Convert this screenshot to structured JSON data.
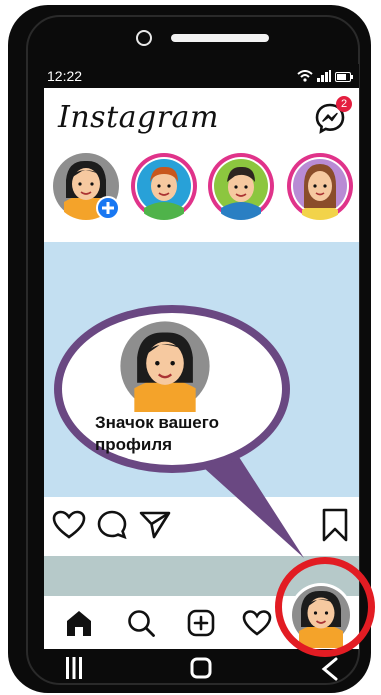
{
  "status_bar": {
    "time": "12:22"
  },
  "header": {
    "app_name": "Instagram",
    "messages_badge": "2"
  },
  "stories": [
    {
      "name": "own-story",
      "skin": "#f6c9a0",
      "hair": "#1c1c1c",
      "shirt": "#f4a32a"
    },
    {
      "name": "story-boy",
      "skin": "#f6c9a0",
      "hair": "#c8571d",
      "shirt": "#4fb34a"
    },
    {
      "name": "story-man",
      "skin": "#f6c9a0",
      "hair": "#2d2520",
      "shirt": "#2a7fc3"
    },
    {
      "name": "story-girl",
      "skin": "#f6c9a0",
      "hair": "#8a4d2a",
      "shirt": "#f2d34a"
    }
  ],
  "callout": {
    "line1": "Значок вашего",
    "line2": "профиля"
  },
  "colors": {
    "post_image": "#c3dff1",
    "bubble_fill": "#ffffff",
    "bubble_border": "#6a4882",
    "story_ring": "#e0338a",
    "highlight": "#e21c23",
    "badge": "#e41e3f"
  }
}
